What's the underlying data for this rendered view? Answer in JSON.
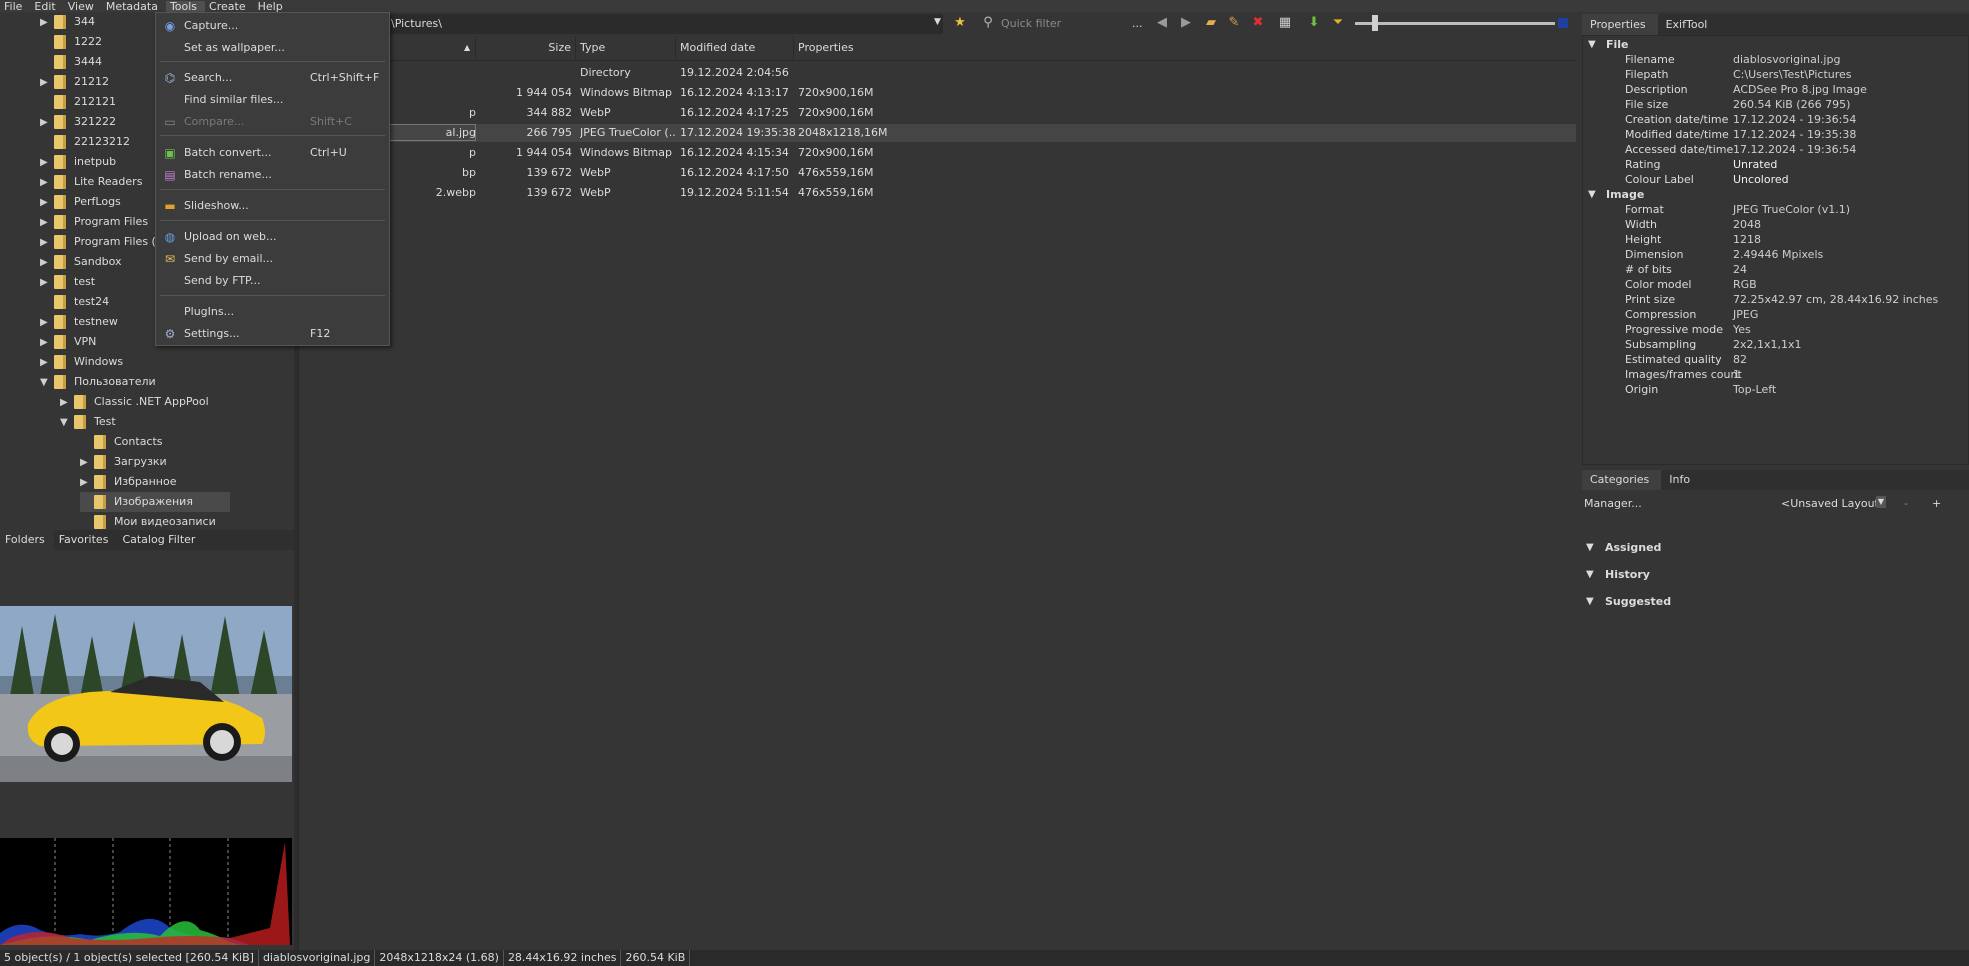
{
  "menubar": {
    "items": [
      "File",
      "Edit",
      "View",
      "Metadata",
      "Tools",
      "Create",
      "Help"
    ]
  },
  "path": {
    "text": "\\Pictures\\",
    "quick_filter_placeholder": "Quick filter",
    "more": "..."
  },
  "tree": {
    "items": [
      {
        "label": "344",
        "arrow": "▶"
      },
      {
        "label": "1222",
        "arrow": ""
      },
      {
        "label": "3444",
        "arrow": ""
      },
      {
        "label": "21212",
        "arrow": "▶"
      },
      {
        "label": "212121",
        "arrow": ""
      },
      {
        "label": "321222",
        "arrow": "▶"
      },
      {
        "label": "22123212",
        "arrow": ""
      },
      {
        "label": "inetpub",
        "arrow": "▶"
      },
      {
        "label": "Lite Readers",
        "arrow": "▶"
      },
      {
        "label": "PerfLogs",
        "arrow": "▶"
      },
      {
        "label": "Program Files",
        "arrow": "▶"
      },
      {
        "label": "Program Files (x86)",
        "arrow": "▶"
      },
      {
        "label": "Sandbox",
        "arrow": "▶"
      },
      {
        "label": "test",
        "arrow": "▶"
      },
      {
        "label": "test24",
        "arrow": ""
      },
      {
        "label": "testnew",
        "arrow": "▶"
      },
      {
        "label": "VPN",
        "arrow": "▶"
      },
      {
        "label": "Windows",
        "arrow": "▶"
      },
      {
        "label": "Пользователи",
        "arrow": "▼"
      },
      {
        "label": "Classic .NET AppPool",
        "arrow": "▶"
      },
      {
        "label": "Test",
        "arrow": "▼"
      },
      {
        "label": "Contacts",
        "arrow": ""
      },
      {
        "label": "Загрузки",
        "arrow": "▶"
      },
      {
        "label": "Избранное",
        "arrow": "▶"
      },
      {
        "label": "Изображения",
        "arrow": ""
      },
      {
        "label": "Мои видеозаписи",
        "arrow": ""
      }
    ]
  },
  "left_tabs": [
    "Folders",
    "Favorites",
    "Catalog Filter"
  ],
  "list": {
    "columns": [
      "Size",
      "Type",
      "Modified date",
      "Properties"
    ],
    "rows": [
      {
        "name": "",
        "size": "",
        "type": "Directory",
        "modified": "19.12.2024 2:04:56",
        "props": ""
      },
      {
        "name": "",
        "size": "1 944 054",
        "type": "Windows Bitmap",
        "modified": "16.12.2024 4:13:17",
        "props": "720x900,16M"
      },
      {
        "name": "p",
        "size": "344 882",
        "type": "WebP",
        "modified": "16.12.2024 4:17:25",
        "props": "720x900,16M"
      },
      {
        "name": "al.jpg",
        "size": "266 795",
        "type": "JPEG TrueColor (...",
        "modified": "17.12.2024 19:35:38",
        "props": "2048x1218,16M"
      },
      {
        "name": "p",
        "size": "1 944 054",
        "type": "Windows Bitmap",
        "modified": "16.12.2024 4:15:34",
        "props": "720x900,16M"
      },
      {
        "name": "bp",
        "size": "139 672",
        "type": "WebP",
        "modified": "16.12.2024 4:17:50",
        "props": "476x559,16M"
      },
      {
        "name": "2.webp",
        "size": "139 672",
        "type": "WebP",
        "modified": "19.12.2024 5:11:54",
        "props": "476x559,16M"
      }
    ]
  },
  "tools_menu": {
    "items": [
      {
        "label": "Capture...",
        "shortcut": "",
        "icon": "capture-icon",
        "disabled": false
      },
      {
        "label": "Set as wallpaper...",
        "shortcut": "",
        "icon": "",
        "disabled": false
      },
      {
        "label": "Search...",
        "shortcut": "Ctrl+Shift+F",
        "icon": "binoculars-icon",
        "disabled": false
      },
      {
        "label": "Find similar files...",
        "shortcut": "",
        "icon": "",
        "disabled": false
      },
      {
        "label": "Compare...",
        "shortcut": "Shift+C",
        "icon": "compare-icon",
        "disabled": true
      },
      {
        "label": "Batch convert...",
        "shortcut": "Ctrl+U",
        "icon": "batch-convert-icon",
        "disabled": false
      },
      {
        "label": "Batch rename...",
        "shortcut": "",
        "icon": "batch-rename-icon",
        "disabled": false
      },
      {
        "label": "Slideshow...",
        "shortcut": "",
        "icon": "slideshow-icon",
        "disabled": false
      },
      {
        "label": "Upload on web...",
        "shortcut": "",
        "icon": "globe-icon",
        "disabled": false
      },
      {
        "label": "Send by email...",
        "shortcut": "",
        "icon": "email-icon",
        "disabled": false
      },
      {
        "label": "Send by FTP...",
        "shortcut": "",
        "icon": "",
        "disabled": false
      },
      {
        "label": "PlugIns...",
        "shortcut": "",
        "icon": "",
        "disabled": false
      },
      {
        "label": "Settings...",
        "shortcut": "F12",
        "icon": "gear-icon",
        "disabled": false
      }
    ]
  },
  "right_tabs": [
    "Properties",
    "ExifTool"
  ],
  "properties": {
    "file_section": "File",
    "file": [
      [
        "Filename",
        "diablosvoriginal.jpg"
      ],
      [
        "Filepath",
        "C:\\Users\\Test\\Pictures"
      ],
      [
        "Description",
        "ACDSee Pro 8.jpg Image"
      ],
      [
        "File size",
        "260.54 KiB (266 795)"
      ],
      [
        "Creation date/time",
        "17.12.2024 - 19:36:54"
      ],
      [
        "Modified date/time",
        "17.12.2024 - 19:35:38"
      ],
      [
        "Accessed date/time",
        "17.12.2024 - 19:36:54"
      ],
      [
        "Rating",
        "Unrated"
      ],
      [
        "Colour Label",
        "Uncolored"
      ]
    ],
    "image_section": "Image",
    "image": [
      [
        "Format",
        "JPEG TrueColor (v1.1)"
      ],
      [
        "Width",
        "2048"
      ],
      [
        "Height",
        "1218"
      ],
      [
        "Dimension",
        "2.49446 Mpixels"
      ],
      [
        "# of bits",
        "24"
      ],
      [
        "Color model",
        "RGB"
      ],
      [
        "Print size",
        "72.25x42.97 cm, 28.44x16.92 inches"
      ],
      [
        "Compression",
        "JPEG"
      ],
      [
        "Progressive mode",
        "Yes"
      ],
      [
        "Subsampling",
        "2x2,1x1,1x1"
      ],
      [
        "Estimated quality",
        "82"
      ],
      [
        "Images/frames count",
        "1"
      ],
      [
        "Origin",
        "Top-Left"
      ]
    ]
  },
  "categories": {
    "tabs": [
      "Categories",
      "Info"
    ],
    "manager": "Manager...",
    "layout": "<Unsaved Layout",
    "minus": "-",
    "plus": "+",
    "sections": [
      "Assigned",
      "History",
      "Suggested"
    ]
  },
  "status": {
    "parts": [
      "5 object(s) / 1 object(s) selected [260.54 KiB]",
      "diablosvoriginal.jpg",
      "2048x1218x24 (1.68)",
      "28.44x16.92 inches",
      "260.54 KiB"
    ]
  },
  "colors": {
    "accent_folder": "#e7c66c",
    "background": "#353535"
  }
}
